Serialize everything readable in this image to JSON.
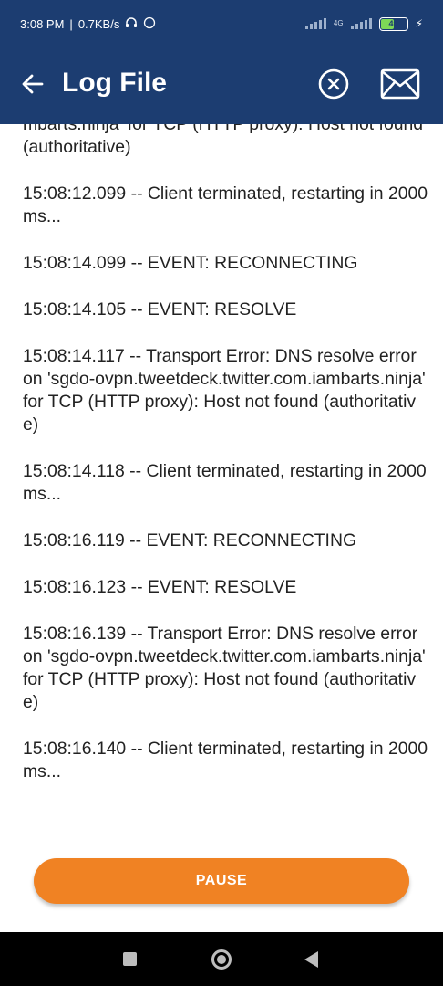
{
  "status_bar": {
    "time": "3:08 PM",
    "speed": "0.7KB/s",
    "network": "4G",
    "battery": "49"
  },
  "header": {
    "title": "Log File",
    "icons": {
      "back": "arrow-left-icon",
      "clear": "close-circle-icon",
      "share": "mail-icon"
    },
    "color": "#1c3d71"
  },
  "log": {
    "entries": [
      "mbarts.ninja' for TCP (HTTP proxy): Host not found (authoritative)",
      "15:08:12.099 -- Client terminated, restarting in 2000 ms...",
      "15:08:14.099 -- EVENT: RECONNECTING",
      "15:08:14.105 -- EVENT: RESOLVE",
      "15:08:14.117 -- Transport Error: DNS resolve error on 'sgdo-ovpn.tweetdeck.twitter.com.iambarts.ninja' for TCP (HTTP proxy): Host not found (authoritative)",
      "15:08:14.118 -- Client terminated, restarting in 2000 ms...",
      "15:08:16.119 -- EVENT: RECONNECTING",
      "15:08:16.123 -- EVENT: RESOLVE",
      "15:08:16.139 -- Transport Error: DNS resolve error on 'sgdo-ovpn.tweetdeck.twitter.com.iambarts.ninja' for TCP (HTTP proxy): Host not found (authoritative)",
      "15:08:16.140 -- Client terminated, restarting in 2000 ms..."
    ]
  },
  "actions": {
    "pause_label": "PAUSE",
    "pause_color": "#f08223"
  },
  "nav_bar": {
    "icons": [
      "recents-square-icon",
      "home-circle-icon",
      "back-triangle-icon"
    ]
  }
}
